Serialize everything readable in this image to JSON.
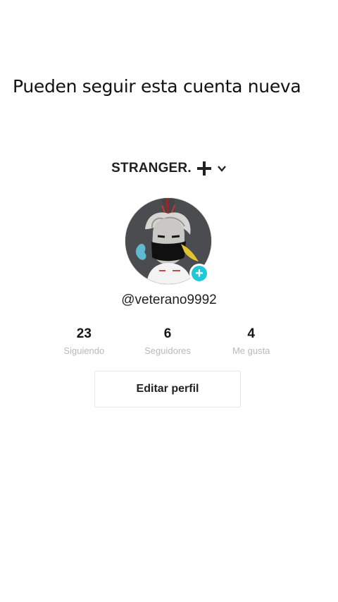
{
  "caption": "Pueden seguir esta cuenta nueva",
  "profile": {
    "account_name": "STRANGER.",
    "handle": "@veterano9992",
    "follow_badge": "+",
    "avatar_icon": "avatar-icon"
  },
  "stats": [
    {
      "value": "23",
      "label": "Siguiendo"
    },
    {
      "value": "6",
      "label": "Seguidores"
    },
    {
      "value": "4",
      "label": "Me gusta"
    }
  ],
  "actions": {
    "edit_profile": "Editar perfil"
  },
  "colors": {
    "accent": "#20c8d8",
    "text": "#1f1f1f",
    "muted": "#b9b9b9"
  }
}
